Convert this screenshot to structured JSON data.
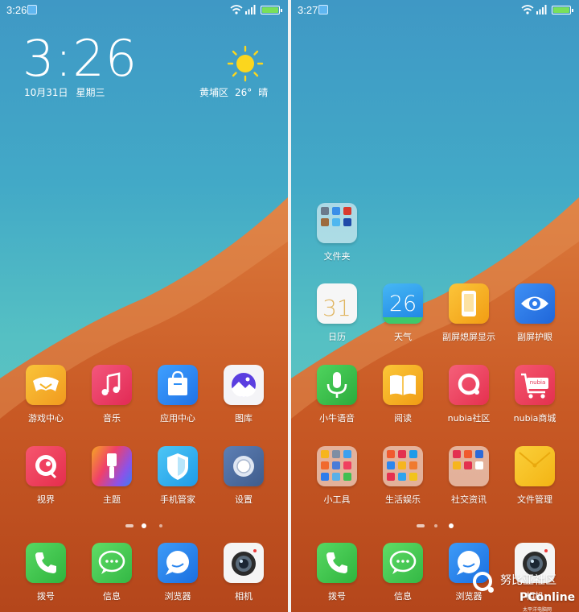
{
  "left_screen": {
    "status": {
      "time": "3:26"
    },
    "clock": {
      "time": "3:26",
      "date": "10月31日",
      "weekday": "星期三"
    },
    "weather": {
      "location": "黄埔区",
      "temperature": "26°",
      "condition": "晴",
      "icon": "sun-icon"
    },
    "apps_row1": [
      {
        "label": "游戏中心",
        "icon": "game-center-icon",
        "color": "#f5b325"
      },
      {
        "label": "音乐",
        "icon": "music-icon",
        "color": "#ee3f6a"
      },
      {
        "label": "应用中心",
        "icon": "app-center-icon",
        "color": "#2d8ef5"
      },
      {
        "label": "图库",
        "icon": "gallery-icon",
        "color": "#f2f2f6"
      }
    ],
    "apps_row2": [
      {
        "label": "视界",
        "icon": "video-icon",
        "color": "#f0405f"
      },
      {
        "label": "主题",
        "icon": "theme-icon",
        "color": "#8b53e8"
      },
      {
        "label": "手机管家",
        "icon": "phone-manager-icon",
        "color": "#2ab0ee"
      },
      {
        "label": "设置",
        "icon": "settings-icon",
        "color": "#4d6c9d"
      }
    ],
    "dock": [
      {
        "label": "拨号",
        "icon": "phone-icon",
        "color": "#43c94f"
      },
      {
        "label": "信息",
        "icon": "messages-icon",
        "color": "#4fcf55"
      },
      {
        "label": "浏览器",
        "icon": "browser-icon",
        "color": "#2b86ee"
      },
      {
        "label": "相机",
        "icon": "camera-icon",
        "color": "#f4f4f4"
      }
    ]
  },
  "right_screen": {
    "status": {
      "time": "3:27"
    },
    "folder_top": {
      "label": "文件夹",
      "icon": "folder-icon"
    },
    "apps_row1": [
      {
        "label": "日历",
        "icon": "calendar-icon",
        "value": "31",
        "color": "#f4f4f4"
      },
      {
        "label": "天气",
        "icon": "weather-icon",
        "value": "26",
        "color": "#2fa3ee"
      },
      {
        "label": "副屏熄屏显示",
        "icon": "sub-screen-display-icon",
        "color": "#f6b51e"
      },
      {
        "label": "副屏护眼",
        "icon": "eye-care-icon",
        "color": "#2f7cec"
      }
    ],
    "apps_row2": [
      {
        "label": "小牛语音",
        "icon": "voice-icon",
        "color": "#3fbf51"
      },
      {
        "label": "阅读",
        "icon": "reading-icon",
        "color": "#f5b623"
      },
      {
        "label": "nubia社区",
        "icon": "nubia-community-icon",
        "color": "#f04a69"
      },
      {
        "label": "nubia商城",
        "icon": "nubia-mall-icon",
        "value": "nubia",
        "color": "#f2415f"
      }
    ],
    "apps_row3": [
      {
        "label": "小工具",
        "icon": "tools-folder-icon"
      },
      {
        "label": "生活娱乐",
        "icon": "life-folder-icon"
      },
      {
        "label": "社交资讯",
        "icon": "social-folder-icon"
      },
      {
        "label": "文件管理",
        "icon": "file-manager-icon",
        "color": "#f7c21c"
      }
    ],
    "dock": [
      {
        "label": "拨号",
        "icon": "phone-icon"
      },
      {
        "label": "信息",
        "icon": "messages-icon"
      },
      {
        "label": "浏览器",
        "icon": "browser-icon"
      },
      {
        "label": "相机",
        "icon": "camera-icon"
      }
    ]
  },
  "watermark": {
    "text": "努比亚社区",
    "site": "PConline",
    "sub": "太平洋电脑网"
  }
}
